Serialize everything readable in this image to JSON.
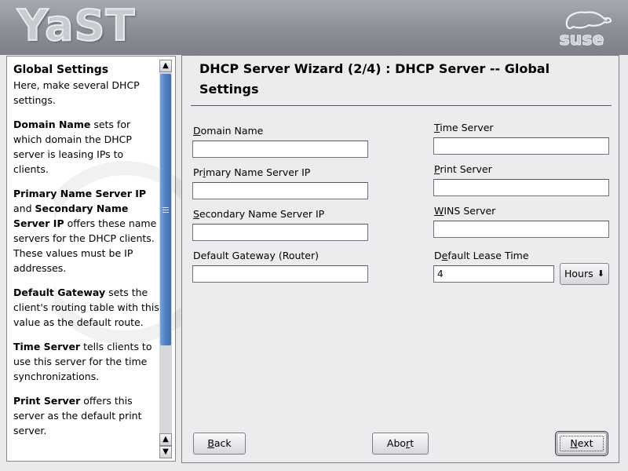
{
  "banner": {
    "logo_text": "YaST",
    "brand": "suse"
  },
  "help": {
    "title": "Global Settings",
    "intro": "Here, make several DHCP settings.",
    "paragraphs": [
      {
        "b1": "Domain Name",
        "t1": " sets for which domain the DHCP server is leasing IPs to clients."
      },
      {
        "b1": "Primary Name Server IP",
        "t1": " and ",
        "b2": "Secondary Name Server IP",
        "t2": " offers these name servers for the DHCP clients. These values must be IP addresses."
      },
      {
        "b1": "Default Gateway",
        "t1": " sets the client's routing table with this value as the default route."
      },
      {
        "b1": "Time Server",
        "t1": " tells clients to use this server for the time synchronizations."
      },
      {
        "b1": "Print Server",
        "t1": " offers this server as the default print server."
      }
    ]
  },
  "main": {
    "title": "DHCP Server Wizard (2/4) : DHCP Server -- Global Settings",
    "fields": {
      "domain_name": {
        "mnemonic": "D",
        "rest": "omain Name",
        "value": ""
      },
      "primary_ns": {
        "pre": "Pr",
        "mnemonic": "i",
        "rest": "mary Name Server IP",
        "value": ""
      },
      "secondary_ns": {
        "mnemonic": "S",
        "rest": "econdary Name Server IP",
        "value": ""
      },
      "default_gateway": {
        "label": "Default Gateway (Router)",
        "value": ""
      },
      "time_server": {
        "mnemonic": "T",
        "rest": "ime Server",
        "value": ""
      },
      "print_server": {
        "mnemonic": "P",
        "rest": "rint Server",
        "value": ""
      },
      "wins_server": {
        "mnemonic": "W",
        "rest": "INS Server",
        "value": ""
      },
      "lease_time": {
        "pre": "D",
        "mnemonic": "e",
        "rest": "fault Lease Time",
        "value": "4",
        "unit": "Hours"
      }
    },
    "buttons": {
      "back": {
        "mnemonic": "B",
        "rest": "ack"
      },
      "abort": {
        "pre": "Abo",
        "mnemonic": "r",
        "rest": "t"
      },
      "next": {
        "mnemonic": "N",
        "rest": "ext"
      }
    }
  },
  "colors": {
    "scroll_accent": "#4f7fc2",
    "banner": "#8b8e97"
  },
  "icons": {
    "scroll_up": "arrow-up-icon",
    "scroll_down": "arrow-down-icon",
    "combo": "dropdown-arrow-icon"
  }
}
